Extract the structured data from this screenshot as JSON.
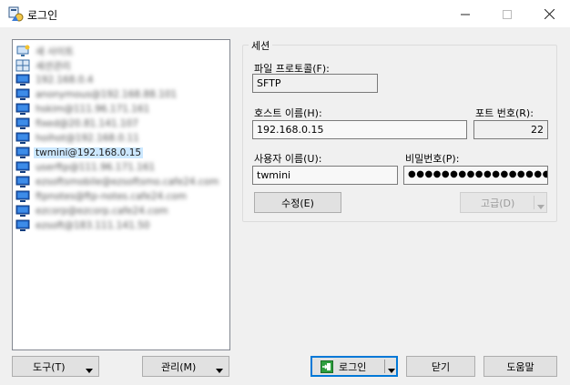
{
  "window": {
    "title": "로그인"
  },
  "site_list": {
    "items": [
      {
        "label": "새 사이트",
        "icon": "new-site-icon",
        "blurred": true
      },
      {
        "label": "세션관리",
        "icon": "workspace-icon",
        "blurred": true
      },
      {
        "label": "192.168.0.4",
        "icon": "monitor-icon",
        "blurred": true
      },
      {
        "label": "anonymous@192.168.88.101",
        "icon": "monitor-icon",
        "blurred": true
      },
      {
        "label": "hskim@111.96.171.161",
        "icon": "monitor-icon",
        "blurred": true
      },
      {
        "label": "fixed@20.81.141.107",
        "icon": "monitor-icon",
        "blurred": true
      },
      {
        "label": "hoihot@192.168.0.11",
        "icon": "monitor-icon",
        "blurred": true
      },
      {
        "label": "twmini@192.168.0.15",
        "icon": "monitor-icon",
        "blurred": false,
        "selected": true
      },
      {
        "label": "userftp@111.96.171.161",
        "icon": "monitor-icon",
        "blurred": true
      },
      {
        "label": "ezsoftsmobile@ezsoftsmo.cafe24.com",
        "icon": "monitor-icon",
        "blurred": true
      },
      {
        "label": "ftpnotes@ftp-notes.cafe24.com",
        "icon": "monitor-icon",
        "blurred": true
      },
      {
        "label": "ezcorp@ezcorp.cafe24.com",
        "icon": "monitor-icon",
        "blurred": true
      },
      {
        "label": "ezsoft@183.111.141.50",
        "icon": "monitor-icon",
        "blurred": true
      }
    ]
  },
  "session": {
    "group_title": "세션",
    "protocol_label": "파일 프로토콜(F):",
    "protocol_value": "SFTP",
    "host_label": "호스트 이름(H):",
    "host_value": "192.168.0.15",
    "port_label": "포트 번호(R):",
    "port_value": "22",
    "user_label": "사용자 이름(U):",
    "user_value": "twmini",
    "password_label": "비밀번호(P):",
    "password_value": "●●●●●●●●●●●●●●●●●●",
    "edit_button": "수정(E)",
    "advanced_button": "고급(D)"
  },
  "footer": {
    "tools_button": "도구(T)",
    "manage_button": "관리(M)",
    "login_button": "로그인",
    "close_button": "닫기",
    "help_button": "도움말"
  },
  "colors": {
    "selected": "#cce8ff",
    "focus": "#0078d7"
  }
}
